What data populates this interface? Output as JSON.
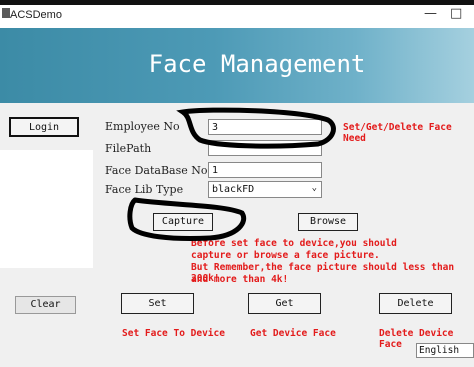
{
  "window": {
    "title": "ACSDemo",
    "minimize": "—",
    "maximize": "□"
  },
  "banner": {
    "title": "Face Management"
  },
  "buttons": {
    "login": "Login",
    "capture": "Capture",
    "browse": "Browse",
    "clear": "Clear",
    "set": "Set",
    "get": "Get",
    "delete": "Delete"
  },
  "form": {
    "employee_no_label": "Employee No",
    "employee_no_value": "3",
    "filepath_label": "FilePath",
    "filepath_value": "",
    "face_db_label": "Face DataBase No",
    "face_db_value": "1",
    "face_lib_label": "Face Lib Type",
    "face_lib_value": "blackFD"
  },
  "hints": {
    "set_get_delete": "Set/Get/Delete Face Need",
    "note_line1": "Before set face to device,you should",
    "note_line2": "capture or browse a face picture.",
    "note_line3": "But Remember,the face picture should less than 200k!",
    "note_line4": "and more than 4k!",
    "set_face": "Set Face To Device",
    "get_face": "Get Device Face",
    "delete_face": "Delete Device Face"
  },
  "language": {
    "selected": "English"
  },
  "colors": {
    "accent_red": "#e31b1b",
    "banner": "#3c8ba6",
    "annotation": "#000000"
  }
}
